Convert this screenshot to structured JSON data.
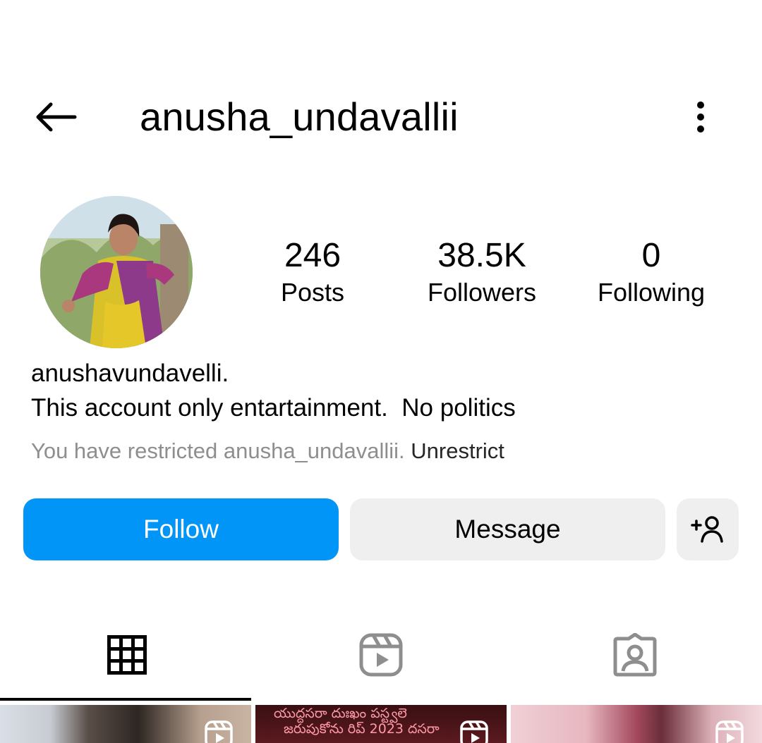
{
  "header": {
    "username": "anusha_undavallii",
    "back_icon": "arrow-left-icon",
    "more_icon": "vertical-ellipsis-icon"
  },
  "profile": {
    "avatar_icon": "profile-avatar"
  },
  "stats": [
    {
      "value": "246",
      "label": "Posts"
    },
    {
      "value": "38.5K",
      "label": "Followers"
    },
    {
      "value": "0",
      "label": "Following"
    }
  ],
  "bio": {
    "name": "anushavundavelli.",
    "text": "This account only entartainment.  No politics"
  },
  "restriction": {
    "text": "You have restricted anusha_undavallii. ",
    "link": "Unrestrict"
  },
  "actions": {
    "follow": "Follow",
    "message": "Message",
    "add_user_icon": "add-person-icon"
  },
  "tabs": [
    {
      "icon": "grid-icon",
      "active": true
    },
    {
      "icon": "reels-icon",
      "active": false
    },
    {
      "icon": "tagged-icon",
      "active": false
    }
  ],
  "grid": {
    "thumb2_text_line1": "యుద్దసరా దుఃఖం పస్ట్వలె",
    "thumb2_text_line2": "జరుపుకోను రిప్ 2023 దసరా"
  },
  "colors": {
    "primary": "#0095f6",
    "secondary_bg": "#efefef",
    "muted_text": "#8e8e8e"
  }
}
